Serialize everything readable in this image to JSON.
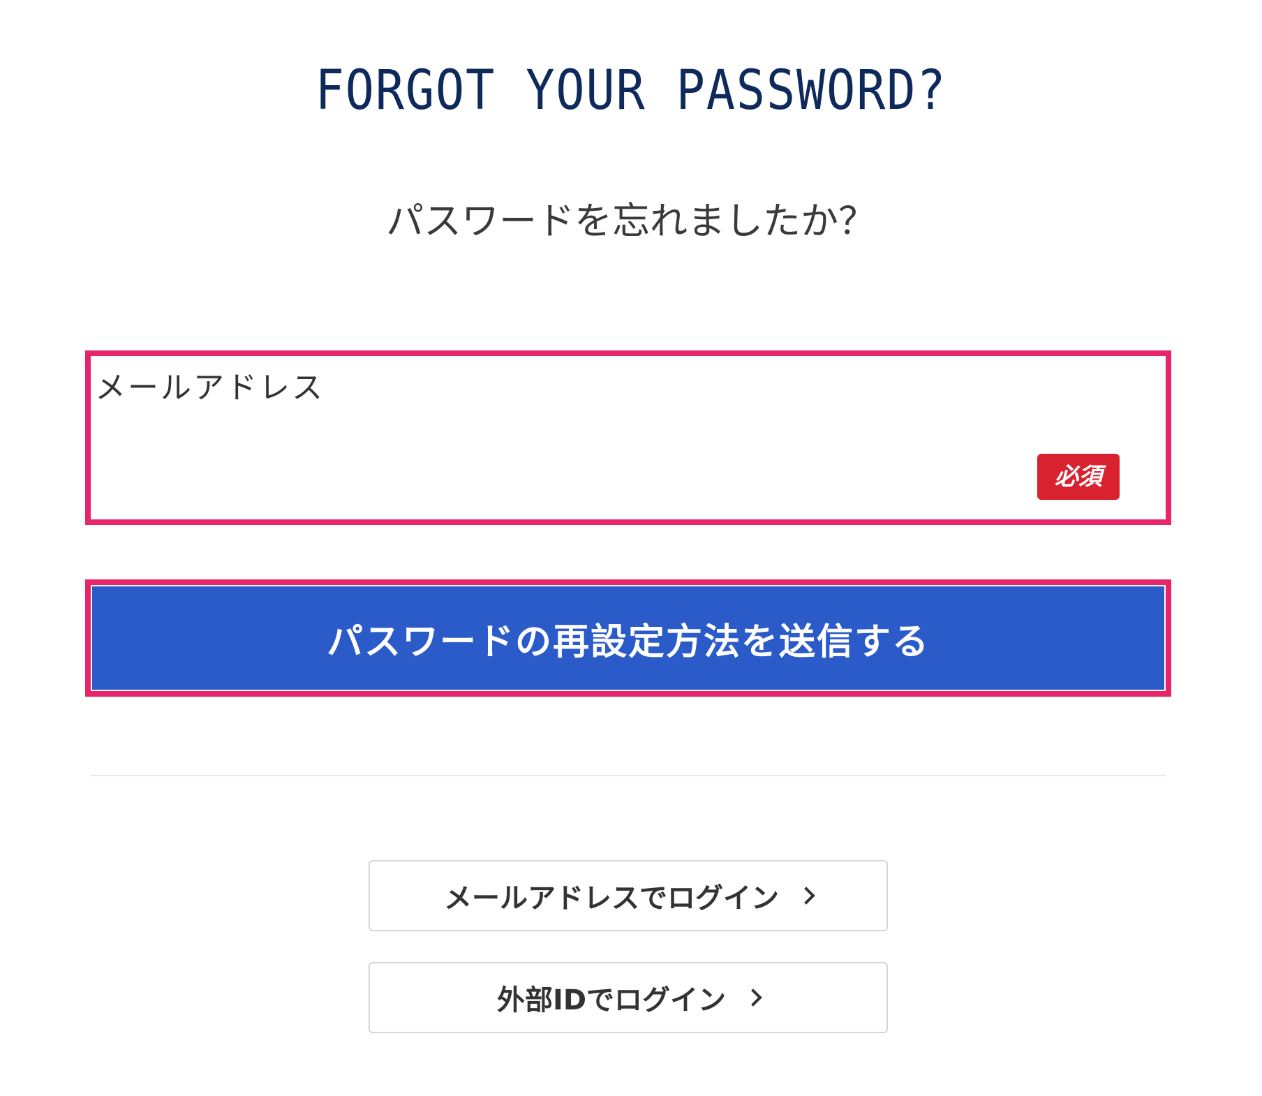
{
  "header": {
    "title_en": "FORGOT YOUR PASSWORD?",
    "title_jp": "パスワードを忘れましたか？"
  },
  "form": {
    "email_label": "メールアドレス",
    "email_value": "",
    "email_placeholder": "",
    "required_badge": "必須",
    "submit_label": "パスワードの再設定方法を送信する"
  },
  "links": {
    "email_login": "メールアドレスでログイン",
    "external_login": "外部IDでログイン"
  },
  "icons": {
    "chevron": "chevron-right-icon"
  },
  "colors": {
    "title": "#0e2a5c",
    "highlight_border": "#e8256b",
    "primary_button": "#2b5ac9",
    "required_badge": "#d9222f"
  }
}
